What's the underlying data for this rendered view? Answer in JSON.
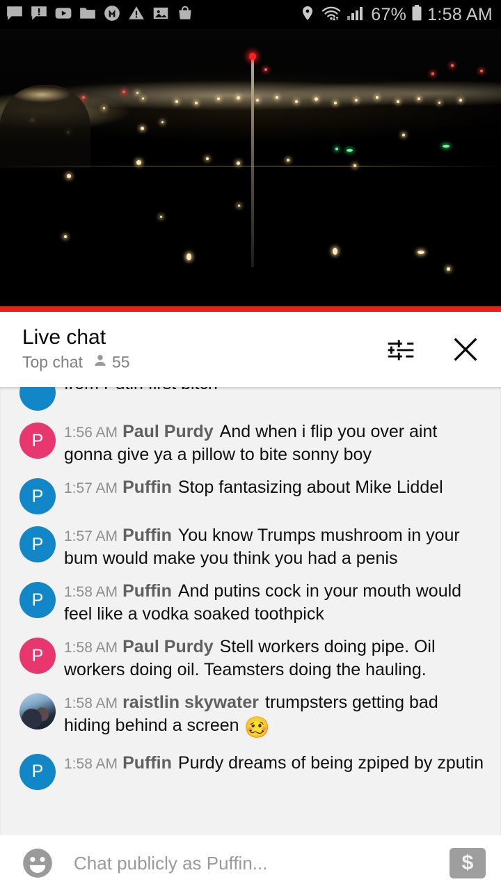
{
  "statusbar": {
    "left_icons": [
      {
        "name": "chat-bubble-icon"
      },
      {
        "name": "chat-alert-icon"
      },
      {
        "name": "youtube-play-icon"
      },
      {
        "name": "folder-icon"
      },
      {
        "name": "circled-m-icon"
      },
      {
        "name": "warning-triangle-icon"
      },
      {
        "name": "image-icon"
      },
      {
        "name": "shopping-bag-icon"
      }
    ],
    "right_icons": [
      {
        "name": "location-pin-icon"
      },
      {
        "name": "wifi-icon"
      },
      {
        "name": "signal-bars-icon"
      },
      {
        "name": "battery-icon"
      }
    ],
    "battery_percent": "67%",
    "clock": "1:58 AM"
  },
  "video": {
    "description": "night cityscape live stream",
    "progress_color": "#e62117"
  },
  "chat_header": {
    "title": "Live chat",
    "mode": "Top chat",
    "viewer_count": "55",
    "settings_icon": "tune-sliders-icon",
    "close_icon": "close-x-icon"
  },
  "messages": [
    {
      "time": "",
      "author": "",
      "text": "from Putin first bitch",
      "avatar_letter": "",
      "avatar_color": "#1287c8",
      "avatar_type": "letter",
      "clipped": true
    },
    {
      "time": "1:56 AM",
      "author": "Paul Purdy",
      "text": "And when i flip you over aint gonna give ya a pillow to bite sonny boy",
      "avatar_letter": "P",
      "avatar_color": "#e8366f",
      "avatar_type": "letter",
      "clipped": false
    },
    {
      "time": "1:57 AM",
      "author": "Puffin",
      "text": "Stop fantasizing about Mike Liddel",
      "avatar_letter": "P",
      "avatar_color": "#1287c8",
      "avatar_type": "letter",
      "clipped": false
    },
    {
      "time": "1:57 AM",
      "author": "Puffin",
      "text": "You know Trumps mushroom in your bum would make you think you had a penis",
      "avatar_letter": "P",
      "avatar_color": "#1287c8",
      "avatar_type": "letter",
      "clipped": false
    },
    {
      "time": "1:58 AM",
      "author": "Puffin",
      "text": "And putins cock in your mouth would feel like a vodka soaked toothpick",
      "avatar_letter": "P",
      "avatar_color": "#1287c8",
      "avatar_type": "letter",
      "clipped": false
    },
    {
      "time": "1:58 AM",
      "author": "Paul Purdy",
      "text": "Stell workers doing pipe. Oil workers doing oil. Teamsters doing the hauling.",
      "avatar_letter": "P",
      "avatar_color": "#e8366f",
      "avatar_type": "letter",
      "clipped": false
    },
    {
      "time": "1:58 AM",
      "author": "raistlin skywater",
      "text": "trumpsters getting bad hiding behind a screen ",
      "emoji": "🥴",
      "avatar_letter": "",
      "avatar_color": "#3b5166",
      "avatar_type": "photo",
      "clipped": false
    },
    {
      "time": "1:58 AM",
      "author": "Puffin",
      "text": "Purdy dreams of being zpiped by zputin",
      "avatar_letter": "P",
      "avatar_color": "#1287c8",
      "avatar_type": "letter",
      "clipped": false
    }
  ],
  "input_bar": {
    "emoji_icon": "emoji-smiley-icon",
    "placeholder": "Chat publicly as Puffin...",
    "value": "",
    "superchat_icon": "dollar-sign-icon",
    "superchat_glyph": "$"
  }
}
